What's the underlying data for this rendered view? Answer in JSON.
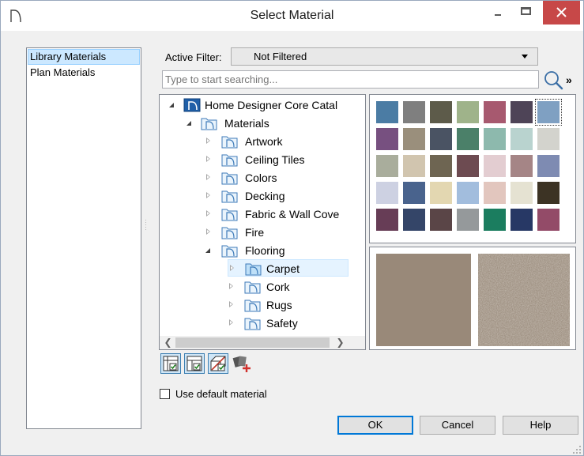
{
  "window": {
    "title": "Select Material"
  },
  "colors": {
    "close_button": "#c74848",
    "selection": "#cce8ff",
    "accent": "#0078d7"
  },
  "sidebar": {
    "items": [
      {
        "label": "Library Materials",
        "selected": true
      },
      {
        "label": "Plan Materials",
        "selected": false
      }
    ]
  },
  "filter": {
    "label": "Active Filter:",
    "value": "Not Filtered"
  },
  "search": {
    "placeholder": "Type to start searching..."
  },
  "tree": {
    "rows": [
      {
        "label": "Home Designer Core Catal",
        "icon": "catalog-icon",
        "expanded": true
      },
      {
        "label": "Materials",
        "icon": "folder-icon",
        "expanded": true
      },
      {
        "label": "Artwork",
        "icon": "folder-icon",
        "expanded": false
      },
      {
        "label": "Ceiling Tiles",
        "icon": "folder-icon",
        "expanded": false
      },
      {
        "label": "Colors",
        "icon": "folder-icon",
        "expanded": false
      },
      {
        "label": "Decking",
        "icon": "folder-icon",
        "expanded": false
      },
      {
        "label": "Fabric & Wall Cove",
        "icon": "folder-icon",
        "expanded": false
      },
      {
        "label": "Fire",
        "icon": "folder-icon",
        "expanded": false
      },
      {
        "label": "Flooring",
        "icon": "folder-icon",
        "expanded": true
      },
      {
        "label": "Carpet",
        "icon": "folder-icon",
        "expanded": false,
        "selected": true
      },
      {
        "label": "Cork",
        "icon": "folder-icon",
        "expanded": false
      },
      {
        "label": "Rugs",
        "icon": "folder-icon",
        "expanded": false
      },
      {
        "label": "Safety",
        "icon": "folder-icon",
        "expanded": false
      }
    ]
  },
  "swatches": {
    "rows": [
      [
        "#4b7ca4",
        "#7f7f7f",
        "#5d5b4a",
        "#9fb38a",
        "#a7596f",
        "#4e4457",
        "#7fa0c2"
      ],
      [
        "#775080",
        "#9a8f7c",
        "#4a5363",
        "#4b8069",
        "#8db9ad",
        "#b9d3cf",
        "#d3d3cd"
      ],
      [
        "#a9ad9c",
        "#d1c5af",
        "#6e6552",
        "#6d4b51",
        "#e3cdd1",
        "#a58586",
        "#7e8bb2"
      ],
      [
        "#cdd1e2",
        "#49638d",
        "#e3d7b1",
        "#a2bddd",
        "#e2c6be",
        "#e5e2d2",
        "#3c3324"
      ],
      [
        "#673d56",
        "#344568",
        "#5a4547",
        "#95999b",
        "#1b7d5f",
        "#273865",
        "#934b68"
      ]
    ],
    "selected": "#7fa0c2"
  },
  "preview": {
    "flat_color": "#998979"
  },
  "default_material": {
    "label": "Use default material",
    "checked": false
  },
  "buttons": {
    "ok": "OK",
    "cancel": "Cancel",
    "help": "Help"
  }
}
